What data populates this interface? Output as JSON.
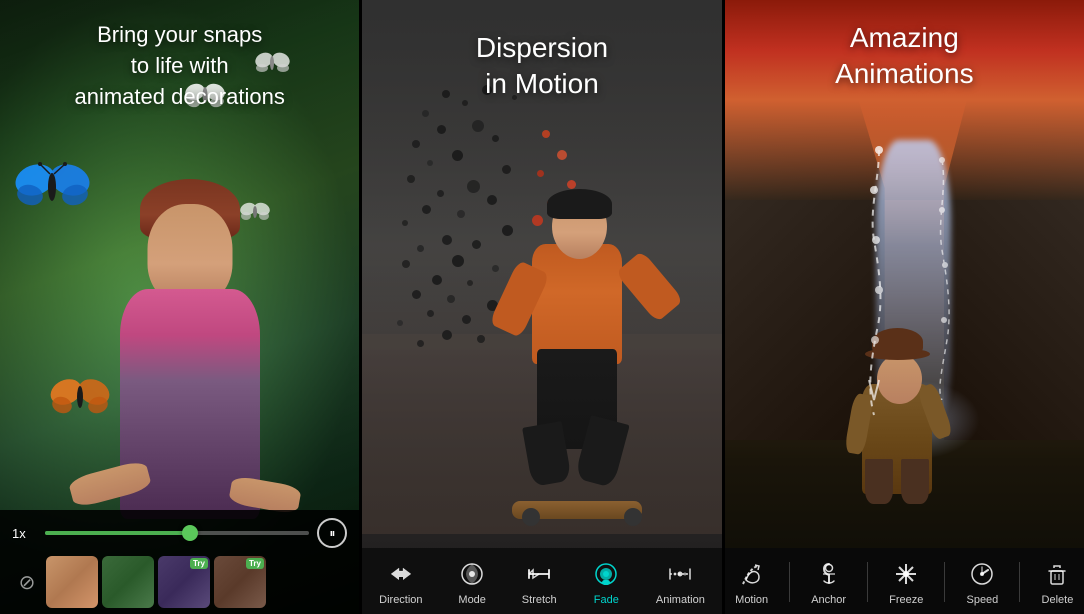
{
  "panels": [
    {
      "id": "panel1",
      "tagline": "Bring your snaps\nto life with\nanimated decorations",
      "speed_label": "1x",
      "slider_percent": 55,
      "controls": {
        "pause_icon": "⏸",
        "no_symbol": "⊘"
      },
      "thumbnails": [
        {
          "id": "thumb1",
          "has_badge": false
        },
        {
          "id": "thumb2",
          "has_badge": false
        },
        {
          "id": "thumb3",
          "has_badge": true,
          "badge_text": "Try"
        },
        {
          "id": "thumb4",
          "has_badge": true,
          "badge_text": "Try"
        }
      ]
    },
    {
      "id": "panel2",
      "tagline": "Dispersion\nin Motion",
      "toolbar": [
        {
          "id": "direction",
          "label": "Direction",
          "icon": "direction",
          "active": false
        },
        {
          "id": "mode",
          "label": "Mode",
          "icon": "mode",
          "active": false
        },
        {
          "id": "stretch",
          "label": "Stretch",
          "icon": "stretch",
          "active": false
        },
        {
          "id": "fade",
          "label": "Fade",
          "icon": "fade",
          "active": true
        },
        {
          "id": "animation",
          "label": "Animation",
          "icon": "animation",
          "active": false
        }
      ]
    },
    {
      "id": "panel3",
      "tagline": "Amazing\nAnimations",
      "toolbar": [
        {
          "id": "motion",
          "label": "Motion",
          "icon": "motion",
          "active": false
        },
        {
          "id": "anchor",
          "label": "Anchor",
          "icon": "anchor",
          "active": false
        },
        {
          "id": "freeze",
          "label": "Freeze",
          "icon": "freeze",
          "active": false
        },
        {
          "id": "speed",
          "label": "Speed",
          "icon": "speed",
          "active": false
        },
        {
          "id": "delete",
          "label": "Delete",
          "icon": "delete",
          "active": false
        }
      ]
    }
  ]
}
